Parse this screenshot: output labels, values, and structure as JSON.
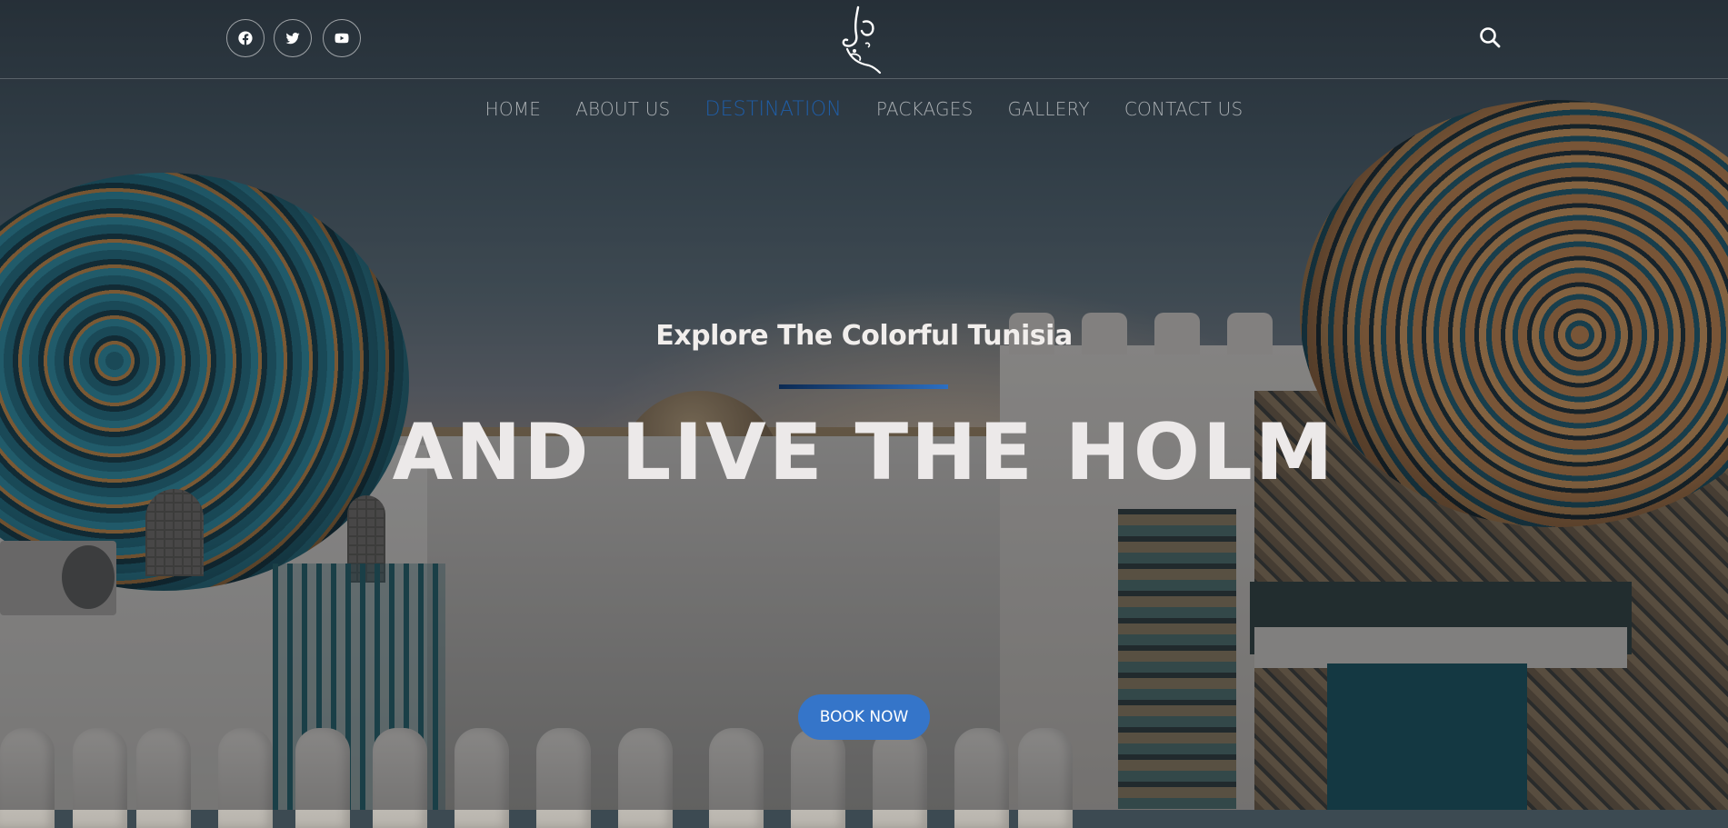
{
  "header": {
    "social": [
      {
        "icon": "facebook-icon",
        "label": "Facebook"
      },
      {
        "icon": "twitter-icon",
        "label": "Twitter"
      },
      {
        "icon": "youtube-icon",
        "label": "YouTube"
      }
    ],
    "logo_icon": "calligraphy-logo",
    "search_icon": "search-icon"
  },
  "nav": {
    "items": [
      {
        "label": "HOME",
        "active": false
      },
      {
        "label": "ABOUT US",
        "active": false
      },
      {
        "label": "DESTINATION",
        "active": true
      },
      {
        "label": "PACKAGES",
        "active": false
      },
      {
        "label": "GALLERY",
        "active": false
      },
      {
        "label": "CONTACT US",
        "active": false
      }
    ]
  },
  "hero": {
    "subtitle": "Explore The Colorful Tunisia",
    "headline": "AND LIVE THE HOLM",
    "cta_label": "BOOK NOW"
  },
  "colors": {
    "accent": "#3575c9",
    "nav_active": "#1f5da6",
    "nav_inactive": "#a9aeb2",
    "divider_start": "#0c2a52",
    "divider_end": "#2c6fc2"
  }
}
